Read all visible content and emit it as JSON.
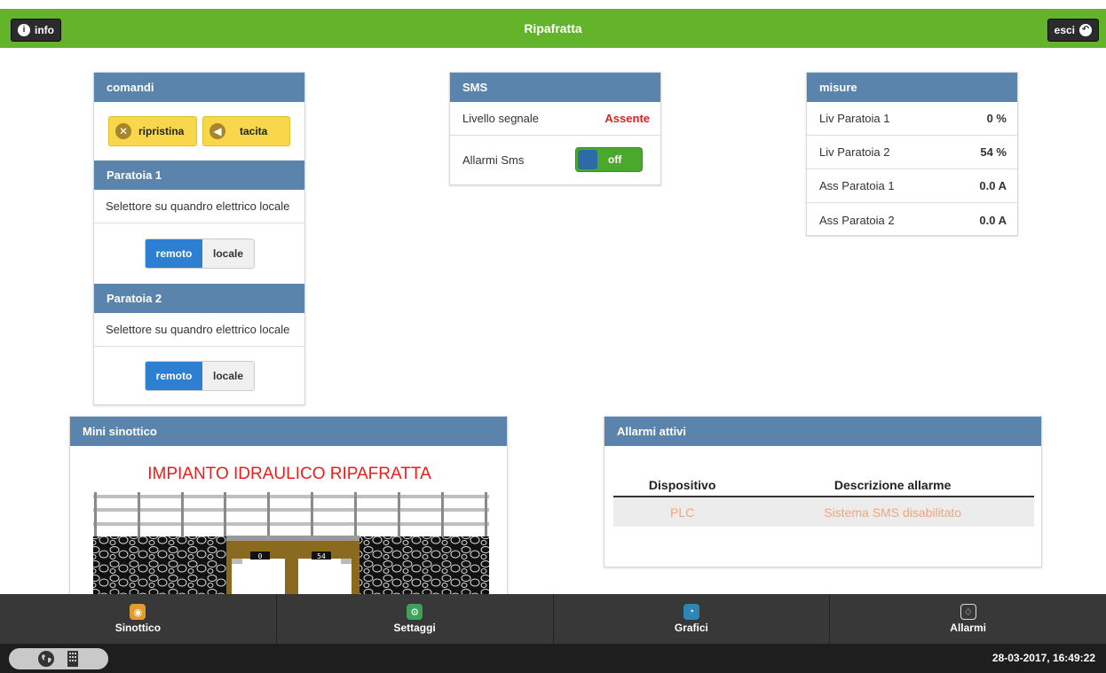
{
  "header": {
    "title": "Ripafratta",
    "info_label": "info",
    "exit_label": "esci"
  },
  "comandi": {
    "title": "comandi",
    "reset_label": "ripristina",
    "mute_label": "tacita",
    "gates": [
      {
        "title": "Paratoia 1",
        "description": "Selettore su quandro elettrico locale",
        "remote_label": "remoto",
        "local_label": "locale"
      },
      {
        "title": "Paratoia 2",
        "description": "Selettore su quandro elettrico locale",
        "remote_label": "remoto",
        "local_label": "locale"
      }
    ]
  },
  "sms": {
    "title": "SMS",
    "signal_label": "Livello segnale",
    "signal_value": "Assente",
    "signal_color": "#e02020",
    "alarms_label": "Allarmi Sms",
    "toggle_label": "off"
  },
  "misure": {
    "title": "misure",
    "rows": [
      {
        "label": "Liv Paratoia 1",
        "value": "0 %"
      },
      {
        "label": "Liv Paratoia 2",
        "value": "54 %"
      },
      {
        "label": "Ass Paratoia 1",
        "value": "0.0 A"
      },
      {
        "label": "Ass Paratoia 2",
        "value": "0.0 A"
      }
    ]
  },
  "mini": {
    "title": "Mini sinottico",
    "diagram_title": "IMPIANTO IDRAULICO RIPAFRATTA",
    "gate1_display": "0",
    "gate2_display": "54"
  },
  "allarmi": {
    "title": "Allarmi attivi",
    "columns": [
      "Dispositivo",
      "Descrizione allarme"
    ],
    "rows": [
      {
        "device": "PLC",
        "description": "Sistema SMS disabilitato"
      }
    ]
  },
  "nav": {
    "items": [
      {
        "label": "Sinottico",
        "icon": "eye-icon",
        "color": "#e39b2a"
      },
      {
        "label": "Settaggi",
        "icon": "gears-icon",
        "color": "#3fa15a"
      },
      {
        "label": "Grafici",
        "icon": "pie-chart-icon",
        "color": "#2e86b8"
      },
      {
        "label": "Allarmi",
        "icon": "bulb-icon",
        "color": "#383838"
      }
    ]
  },
  "status": {
    "datetime": "28-03-2017, 16:49:22"
  }
}
